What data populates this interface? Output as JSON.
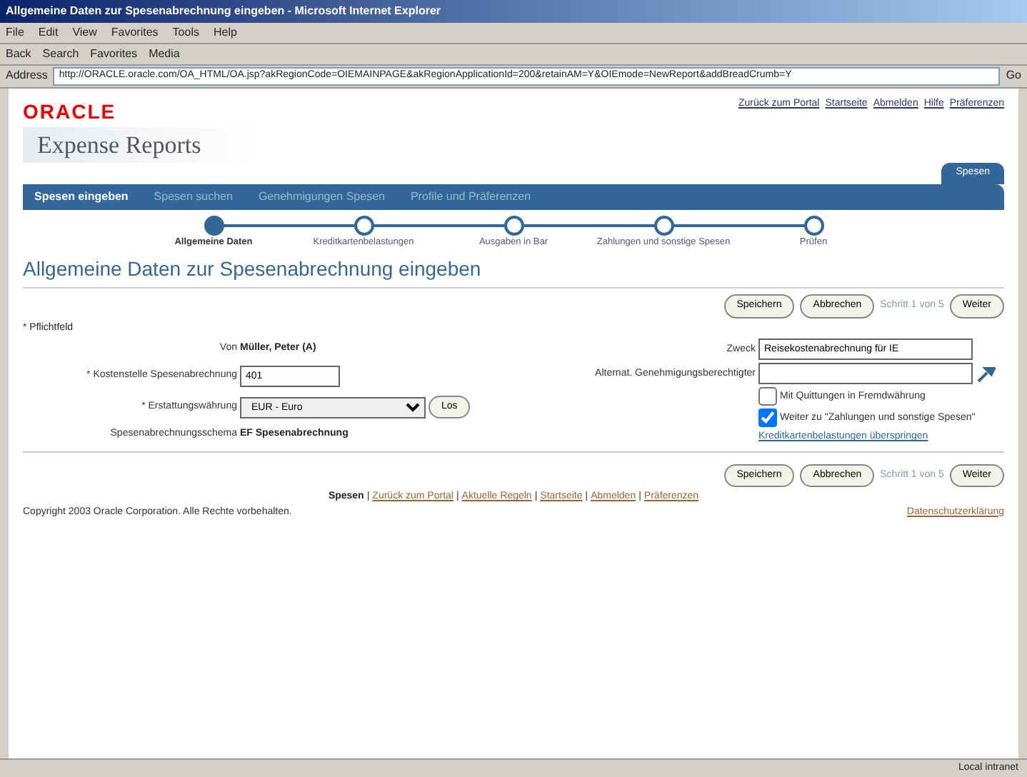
{
  "window": {
    "title": "Allgemeine Daten zur Spesenabrechnung eingeben - Microsoft Internet Explorer"
  },
  "menu": [
    "File",
    "Edit",
    "View",
    "Favorites",
    "Tools",
    "Help"
  ],
  "toolbar": [
    "Back",
    "Search",
    "Favorites",
    "Media"
  ],
  "address": {
    "label": "Address",
    "value": "http://ORACLE.oracle.com/OA_HTML/OA.jsp?akRegionCode=OIEMAINPAGE&akRegionApplicationId=200&retainAM=Y&OIEmode=NewReport&addBreadCrumb=Y",
    "go": "Go"
  },
  "header": {
    "logo": "ORACLE",
    "product": "Expense Reports",
    "global_links": [
      "Zurück zum Portal",
      "Startseite",
      "Abmelden",
      "Hilfe",
      "Präferenzen"
    ],
    "global_tab": "Spesen"
  },
  "tabs": [
    {
      "label": "Spesen eingeben",
      "selected": true
    },
    {
      "label": "Spesen suchen",
      "selected": false
    },
    {
      "label": "Genehmigungen Spesen",
      "selected": false
    },
    {
      "label": "Profile und Präferenzen",
      "selected": false
    }
  ],
  "train": [
    {
      "label": "Allgemeine Daten",
      "selected": true
    },
    {
      "label": "Kreditkartenbelastungen",
      "selected": false
    },
    {
      "label": "Ausgaben in Bar",
      "selected": false
    },
    {
      "label": "Zahlungen und sonstige Spesen",
      "selected": false
    },
    {
      "label": "Prüfen",
      "selected": false
    }
  ],
  "page_title": "Allgemeine Daten zur Spesenabrechnung eingeben",
  "actions": {
    "buttons": [
      "Speichern",
      "Abbrechen"
    ],
    "step": "Schritt 1 von 5",
    "next": "Weiter"
  },
  "required_note": "* Pflichtfeld",
  "left_fields": [
    {
      "kind": "text",
      "label": "Von",
      "value": "Müller, Peter (A)"
    },
    {
      "kind": "input",
      "label": "* Kostenstelle Spesenabrechnung",
      "value": "401"
    },
    {
      "kind": "select",
      "label": "* Erstattungswährung",
      "value": "EUR - Euro",
      "button": "Los"
    },
    {
      "kind": "text",
      "label": "Spesenabrechnungsschema",
      "value": "EF Spesenabrechnung"
    }
  ],
  "right_fields": [
    {
      "kind": "input",
      "label": "Zweck",
      "value": "Reisekostenabrechnung für IE"
    },
    {
      "kind": "lookup",
      "label": "Alternat. Genehmigungsberechtigter"
    }
  ],
  "checkboxes": [
    {
      "label": "Mit Quittungen in Fremdwährung",
      "checked": false
    },
    {
      "label": "Weiter zu \"Zahlungen und sonstige Spesen\"",
      "checked": true
    }
  ],
  "tip": "Kreditkartenbelastungen überspringen",
  "bottom_actions": {
    "buttons": [
      "Speichern",
      "Abbrechen"
    ],
    "step": "Schritt 1 von 5",
    "next": "Weiter"
  },
  "footer_separator": "|",
  "footer_links": [
    "Spesen",
    "Zurück zum Portal",
    "Aktuelle Regeln",
    "Startseite",
    "Abmelden",
    "Präferenzen"
  ],
  "copyright": "Copyright 2003 Oracle Corporation. Alle Rechte vorbehalten.",
  "privacy": "Datenschutzerklärung",
  "status_bar": {
    "zone": "Local intranet"
  }
}
